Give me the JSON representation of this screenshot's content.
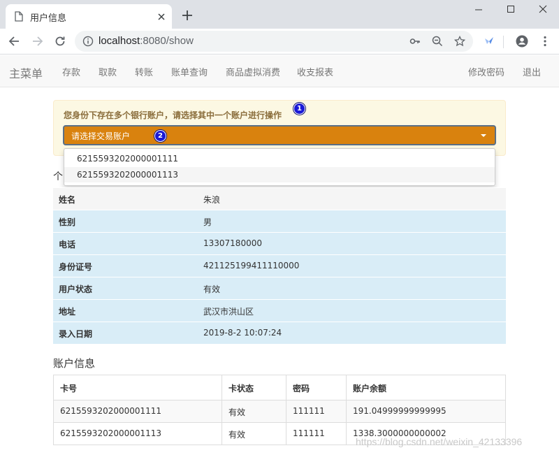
{
  "browser": {
    "tab_title": "用户信息",
    "url_host": "localhost",
    "url_rest": ":8080/show"
  },
  "navbar": {
    "brand": "主菜单",
    "items": [
      "存款",
      "取款",
      "转账",
      "账单查询",
      "商品虚拟消费",
      "收支报表"
    ],
    "right_items": [
      "修改密码",
      "退出"
    ]
  },
  "alert": {
    "message": "您身份下存在多个银行账户，请选择其中一个账户进行操作",
    "badge1": "1",
    "badge2": "2",
    "select_placeholder": "请选择交易账户",
    "options": [
      "6215593202000001111",
      "6215593202000001113"
    ]
  },
  "personal": {
    "title_fragment": "个",
    "rows": [
      {
        "label": "姓名",
        "value": "朱浪"
      },
      {
        "label": "性别",
        "value": "男"
      },
      {
        "label": "电话",
        "value": "13307180000"
      },
      {
        "label": "身份证号",
        "value": "421125199411110000"
      },
      {
        "label": "用户状态",
        "value": "有效"
      },
      {
        "label": "地址",
        "value": "武汉市洪山区"
      },
      {
        "label": "录入日期",
        "value": "2019-8-2 10:07:24"
      }
    ],
    "row_colors": {
      "first": "#f5f5f5",
      "rest": "#d9edf7"
    }
  },
  "accounts": {
    "title": "账户信息",
    "headers": [
      "卡号",
      "卡状态",
      "密码",
      "账户余额"
    ],
    "rows": [
      [
        "6215593202000001111",
        "有效",
        "111111",
        "191.04999999999995"
      ],
      [
        "6215593202000001113",
        "有效",
        "111111",
        "1338.3000000000002"
      ]
    ]
  },
  "watermark": "https://blog.csdn.net/weixin_42133396"
}
